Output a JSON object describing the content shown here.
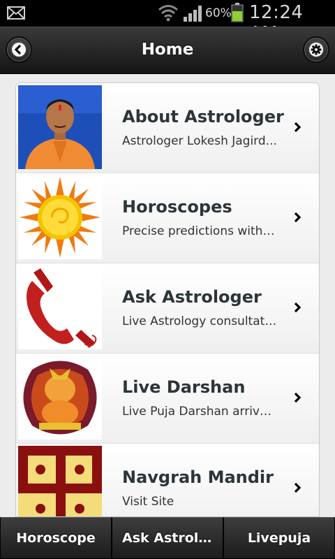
{
  "status_bar": {
    "battery_percent": "60%",
    "time": "12:24 AM",
    "icons": [
      "mail-icon",
      "wifi-icon",
      "signal-icon",
      "battery-icon"
    ]
  },
  "header": {
    "title": "Home",
    "back_icon": "chevron-left-icon",
    "settings_icon": "gear-icon"
  },
  "list": {
    "items": [
      {
        "title": "About Astrologer",
        "desc": "Astrologer Lokesh Jagird...",
        "thumb": "astrologer-photo"
      },
      {
        "title": "Horoscopes",
        "desc": "Precise predictions with ...",
        "thumb": "sun-image"
      },
      {
        "title": "Ask Astrologer",
        "desc": "Live Astrology consultati...",
        "thumb": "phone-receiver-image"
      },
      {
        "title": "Live Darshan",
        "desc": "Live Puja Darshan arrive...",
        "thumb": "ganesha-image"
      },
      {
        "title": "Navgrah Mandir",
        "desc": "Visit Site",
        "thumb": "swastika-image"
      }
    ]
  },
  "tabbar": {
    "tabs": [
      {
        "label": "Horoscope"
      },
      {
        "label": "Ask Astrol..."
      },
      {
        "label": "Livepuja"
      }
    ]
  },
  "colors": {
    "header_bg": "#1e1e1e",
    "title_text": "#2c3539",
    "battery_green": "#8bd130"
  }
}
